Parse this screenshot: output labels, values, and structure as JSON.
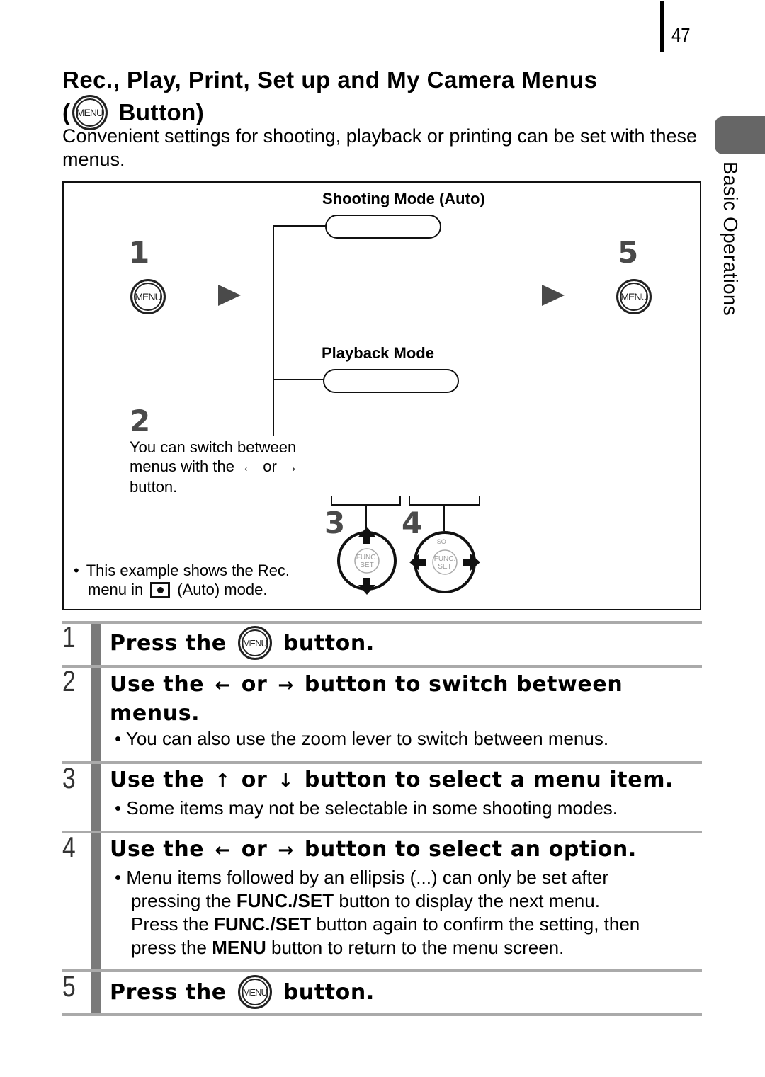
{
  "page": {
    "number": "47",
    "section_tab": "Basic Operations"
  },
  "title": {
    "line1": "Rec., Play, Print, Set up and My Camera Menus",
    "line2_open": "(",
    "line2_text": "Button)",
    "menu_icon_label": "MENU"
  },
  "intro": "Convenient settings for shooting, playback or printing can be set with these menus.",
  "diagram": {
    "step1_num": "1",
    "step5_num": "5",
    "step2_num": "2",
    "step3_num": "3",
    "step4_num": "4",
    "menu_icon_label": "MENU",
    "shooting_mode_label": "Shooting Mode (Auto)",
    "playback_mode_label": "Playback Mode",
    "switch_note_line1": "You can switch between",
    "switch_note_line2_pre": "menus with the",
    "switch_note_or": "or",
    "switch_note_line3": "button.",
    "arrow_left": "←",
    "arrow_right": "→",
    "func_set_label_1": "FUNC.",
    "func_set_label_2": "SET",
    "dial4_top_label": "ISO",
    "example_note_line1": "This example shows the Rec.",
    "example_note_line2_pre": "menu in",
    "example_note_line2_post": "(Auto) mode.",
    "bullet": "•"
  },
  "steps": [
    {
      "num": "1",
      "head_pre": "Press the",
      "head_post": "button.",
      "icon": "MENU"
    },
    {
      "num": "2",
      "head_line1_pre": "Use the",
      "head_or": "or",
      "head_line1_post": "button to switch between",
      "head_line2": "menus.",
      "bullet": "You can also use the zoom lever to switch between menus."
    },
    {
      "num": "3",
      "head_pre": "Use the",
      "head_or": "or",
      "head_post": "button to select a menu item.",
      "bullet": "Some items may not be selectable in some shooting modes."
    },
    {
      "num": "4",
      "head_pre": "Use the",
      "head_or": "or",
      "head_post": "button to select an option.",
      "bullet_l1": "Menu items followed by an ellipsis (...) can only be set after",
      "bullet_l2_pre": "pressing the",
      "bullet_l2_bold": "FUNC./SET",
      "bullet_l2_post": "button to display the next menu.",
      "bullet_l3_pre": "Press the",
      "bullet_l3_bold": "FUNC./SET",
      "bullet_l3_post": "button again to confirm the setting, then",
      "bullet_l4_pre": "press the",
      "bullet_l4_bold": "MENU",
      "bullet_l4_post": "button to return to the menu screen."
    },
    {
      "num": "5",
      "head_pre": "Press the",
      "head_post": "button.",
      "icon": "MENU"
    }
  ],
  "arrows": {
    "left": "←",
    "right": "→",
    "up": "↑",
    "down": "↓"
  },
  "colors": {
    "tab_gray": "#666666",
    "step_bar": "#7a7a7a",
    "rule": "#aaaaaa",
    "big_number": "#4a4a4a"
  }
}
